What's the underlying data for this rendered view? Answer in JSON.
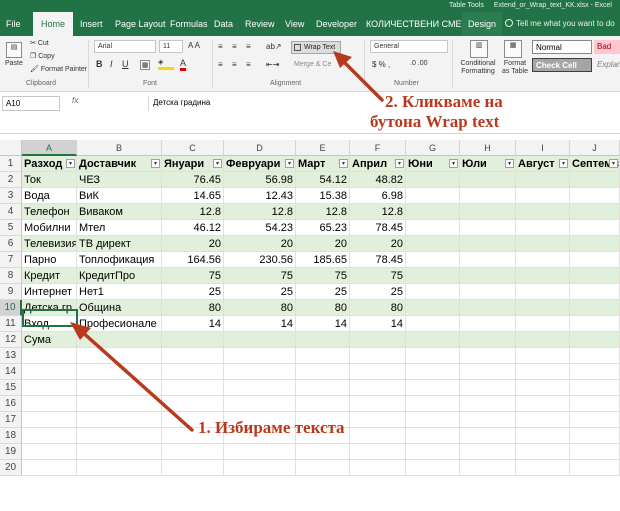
{
  "window": {
    "table_tools": "Table Tools",
    "title": "Extend_or_Wrap_text_KK.xlsx - Excel"
  },
  "tabs": [
    "File",
    "Home",
    "Insert",
    "Page Layout",
    "Formulas",
    "Data",
    "Review",
    "View",
    "Developer",
    "КОЛИЧЕСТВЕНИ СМЕТКИ",
    "Design"
  ],
  "tell_me": "Tell me what you want to do",
  "ribbon": {
    "clipboard": {
      "paste": "Paste",
      "cut": "Cut",
      "copy": "Copy",
      "format_painter": "Format Painter",
      "label": "Clipboard"
    },
    "font": {
      "name": "Arial",
      "size": "11",
      "label": "Font",
      "bold": "B",
      "italic": "I",
      "underline": "U"
    },
    "alignment": {
      "wrap_text": "Wrap Text",
      "merge": "Merge & Ce",
      "label": "Alignment"
    },
    "number": {
      "format": "General",
      "label": "Number"
    },
    "styles": {
      "conditional": "Conditional Formatting",
      "format_as_table": "Format as Table",
      "normal": "Normal",
      "bad": "Bad",
      "check_cell": "Check Cell",
      "explanatory": "Explana"
    }
  },
  "formula_bar": {
    "name_box": "A10",
    "fx": "fx",
    "content": "Детска градина"
  },
  "columns": [
    "A",
    "B",
    "C",
    "D",
    "E",
    "F",
    "G",
    "H",
    "I",
    "J"
  ],
  "headers": [
    "Разход",
    "Доставчик",
    "Януари",
    "Февруари",
    "Март",
    "Април",
    "Юни",
    "Юли",
    "Август",
    "Септемв"
  ],
  "rows": [
    {
      "num": "2",
      "a": "Ток",
      "b": "ЧЕЗ",
      "vals": [
        "76.45",
        "56.98",
        "54.12",
        "48.82"
      ]
    },
    {
      "num": "3",
      "a": "Вода",
      "b": "ВиК",
      "vals": [
        "14.65",
        "12.43",
        "15.38",
        "6.98"
      ]
    },
    {
      "num": "4",
      "a": "Телефон",
      "b": "Виваком",
      "vals": [
        "12.8",
        "12.8",
        "12.8",
        "12.8"
      ]
    },
    {
      "num": "5",
      "a": "Мобилни",
      "b": "Мтел",
      "vals": [
        "46.12",
        "54.23",
        "65.23",
        "78.45"
      ]
    },
    {
      "num": "6",
      "a": "Телевизия",
      "b": "ТВ директ",
      "vals": [
        "20",
        "20",
        "20",
        "20"
      ]
    },
    {
      "num": "7",
      "a": "Парно",
      "b": "Топлофикация",
      "vals": [
        "164.56",
        "230.56",
        "185.65",
        "78.45"
      ]
    },
    {
      "num": "8",
      "a": "Кредит",
      "b": "КредитПро",
      "vals": [
        "75",
        "75",
        "75",
        "75"
      ]
    },
    {
      "num": "9",
      "a": "Интернет",
      "b": "Нет1",
      "vals": [
        "25",
        "25",
        "25",
        "25"
      ]
    },
    {
      "num": "10",
      "a": "Детска гр",
      "b": "Община",
      "vals": [
        "80",
        "80",
        "80",
        "80"
      ]
    },
    {
      "num": "11",
      "a": "Вход",
      "b": "Професионале",
      "vals": [
        "14",
        "14",
        "14",
        "14"
      ]
    },
    {
      "num": "12",
      "a": "Сума",
      "b": "",
      "vals": [
        "",
        "",
        "",
        ""
      ]
    }
  ],
  "empty_rows": [
    "13",
    "14",
    "15",
    "16",
    "17",
    "18",
    "19",
    "20"
  ],
  "annotations": {
    "step1": "1. Избираме текста",
    "step2_line1": "2. Кликваме на",
    "step2_line2": "бутона Wrap text"
  },
  "colors": {
    "excel_green": "#217346",
    "band": "#e2efda",
    "annotation": "#b73a1f"
  }
}
